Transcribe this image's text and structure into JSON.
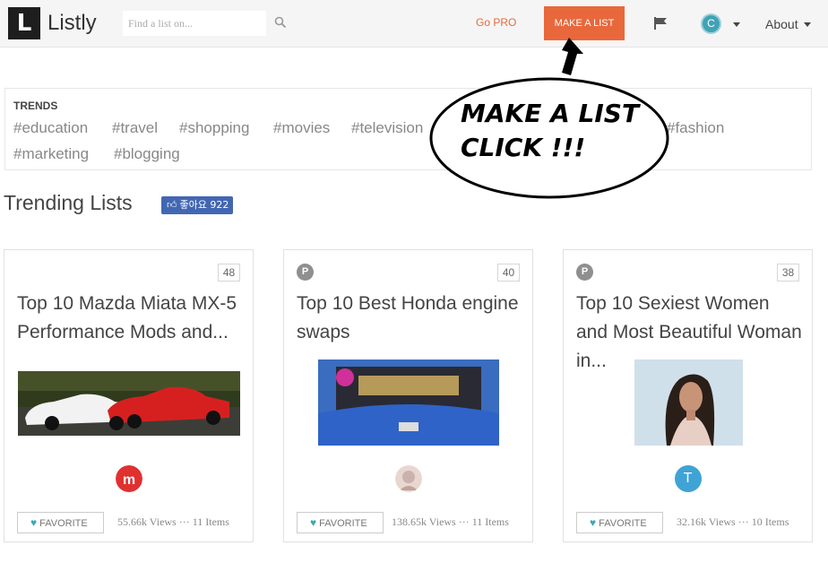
{
  "header": {
    "logo_letter": "L",
    "logo_text": "Listly",
    "search_placeholder": "Find a list on...",
    "go_pro": "Go PRO",
    "make_list": "MAKE A LIST",
    "avatar_letter": "C",
    "about": "About",
    "icons": [
      "search-icon",
      "flag-icon",
      "chevron-down-icon"
    ]
  },
  "trends": {
    "title": "TRENDS",
    "row1": [
      "#education",
      "#travel",
      "#shopping",
      "#movies",
      "#television",
      "#fashion"
    ],
    "row2": [
      "#marketing",
      "#blogging"
    ]
  },
  "callout": {
    "line1": "MAKE  A  LIST",
    "line2": "CLICK !!!"
  },
  "trending": {
    "title": "Trending Lists",
    "like_label": "좋아요 922"
  },
  "cards": [
    {
      "badge": "",
      "count": "48",
      "title": "Top 10 Mazda Miata MX-5 Performance Mods and...",
      "favorite": "FAVORITE",
      "stats": "55.66k Views ··· 11 Items"
    },
    {
      "badge": "P",
      "count": "40",
      "title": "Top 10 Best Honda engine swaps",
      "favorite": "FAVORITE",
      "stats": "138.65k Views ··· 11 Items"
    },
    {
      "badge": "P",
      "count": "38",
      "title": "Top 10 Sexiest Women and Most Beautiful Woman in...",
      "favorite": "FAVORITE",
      "stats": "32.16k Views ··· 10 Items",
      "owner_letter": "T"
    }
  ],
  "colors": {
    "accent": "#e8683c",
    "teal": "#3fa3b6",
    "facebook": "#4267b2"
  }
}
